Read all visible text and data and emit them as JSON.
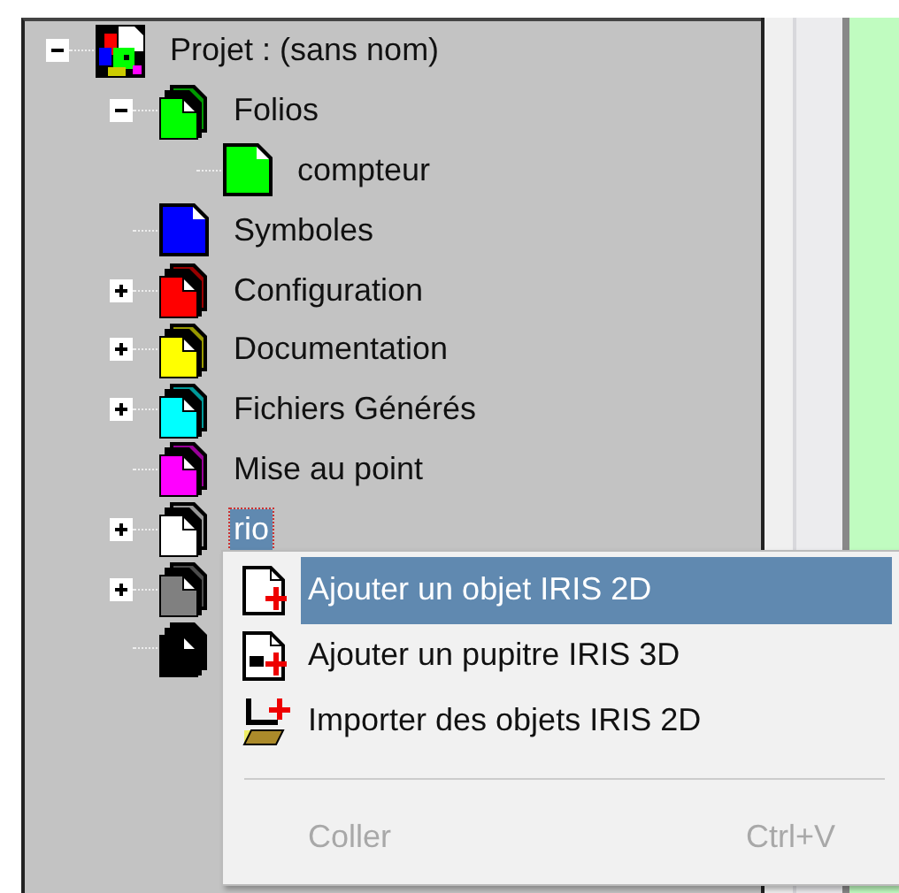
{
  "tree": {
    "items": [
      {
        "label": "Projet : (sans nom)",
        "kind": "project",
        "expanded": true,
        "selected": false,
        "children": [
          {
            "label": "Folios",
            "kind": "stack",
            "color": "#00ff00",
            "expanded": true,
            "selected": false,
            "children": [
              {
                "label": "compteur",
                "kind": "page",
                "color": "#00ff00",
                "selected": false
              }
            ]
          },
          {
            "label": "Symboles",
            "kind": "page",
            "color": "#0000ff",
            "selected": false
          },
          {
            "label": "Configuration",
            "kind": "stack",
            "color": "#ff0000",
            "expanded": false,
            "selected": false
          },
          {
            "label": "Documentation",
            "kind": "stack",
            "color": "#ffff00",
            "expanded": false,
            "selected": false
          },
          {
            "label": "Fichiers Générés",
            "kind": "stack",
            "color": "#00ffff",
            "expanded": false,
            "selected": false
          },
          {
            "label": "Mise au point",
            "kind": "stack",
            "color": "#ff00ff",
            "selected": false
          },
          {
            "label": "rio",
            "kind": "stack",
            "color": "#ffffff",
            "expanded": false,
            "selected": true
          },
          {
            "kind": "stack",
            "color": "#808080",
            "expanded": false,
            "selected": false
          },
          {
            "kind": "stack",
            "color": "#000000",
            "selected": false
          }
        ]
      }
    ]
  },
  "context_menu": {
    "items": [
      {
        "kind": "command",
        "label": "Ajouter un objet IRIS 2D",
        "selected": true,
        "disabled": false
      },
      {
        "kind": "command",
        "label": "Ajouter un pupitre IRIS 3D",
        "selected": false,
        "disabled": false
      },
      {
        "kind": "command",
        "label": "Importer des objets IRIS 2D",
        "selected": false,
        "disabled": false
      },
      {
        "kind": "separator"
      },
      {
        "kind": "command",
        "label": "Coller",
        "shortcut": "Ctrl+V",
        "selected": false,
        "disabled": true
      }
    ]
  }
}
